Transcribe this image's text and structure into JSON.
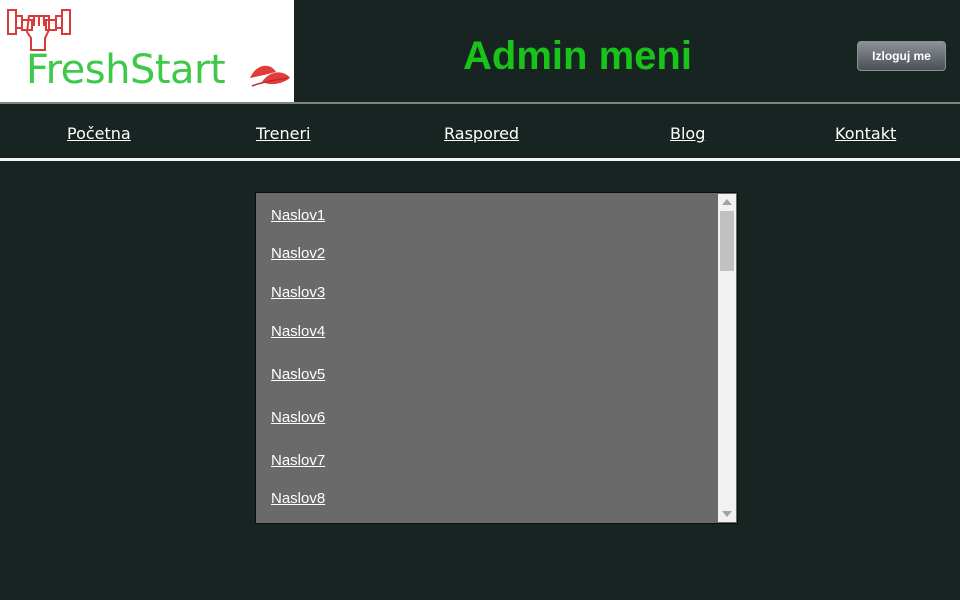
{
  "header": {
    "logo_text": "FreshStart",
    "logo_icon": "raised-fist-icon",
    "title": "Admin meni",
    "logout_label": "Izloguj me"
  },
  "nav": {
    "items": [
      {
        "label": "Početna"
      },
      {
        "label": "Treneri"
      },
      {
        "label": "Raspored"
      },
      {
        "label": "Blog"
      },
      {
        "label": "Kontakt"
      }
    ]
  },
  "list": {
    "items": [
      {
        "label": "Naslov1"
      },
      {
        "label": "Naslov2"
      },
      {
        "label": "Naslov3"
      },
      {
        "label": "Naslov4"
      },
      {
        "label": "Naslov5"
      },
      {
        "label": "Naslov6"
      },
      {
        "label": "Naslov7"
      },
      {
        "label": "Naslov8"
      }
    ]
  },
  "colors": {
    "background": "#182421",
    "title_green": "#19c41a",
    "logo_green": "#3ec94a",
    "logo_red": "#d93b3b",
    "list_background": "#6a6a6a"
  }
}
